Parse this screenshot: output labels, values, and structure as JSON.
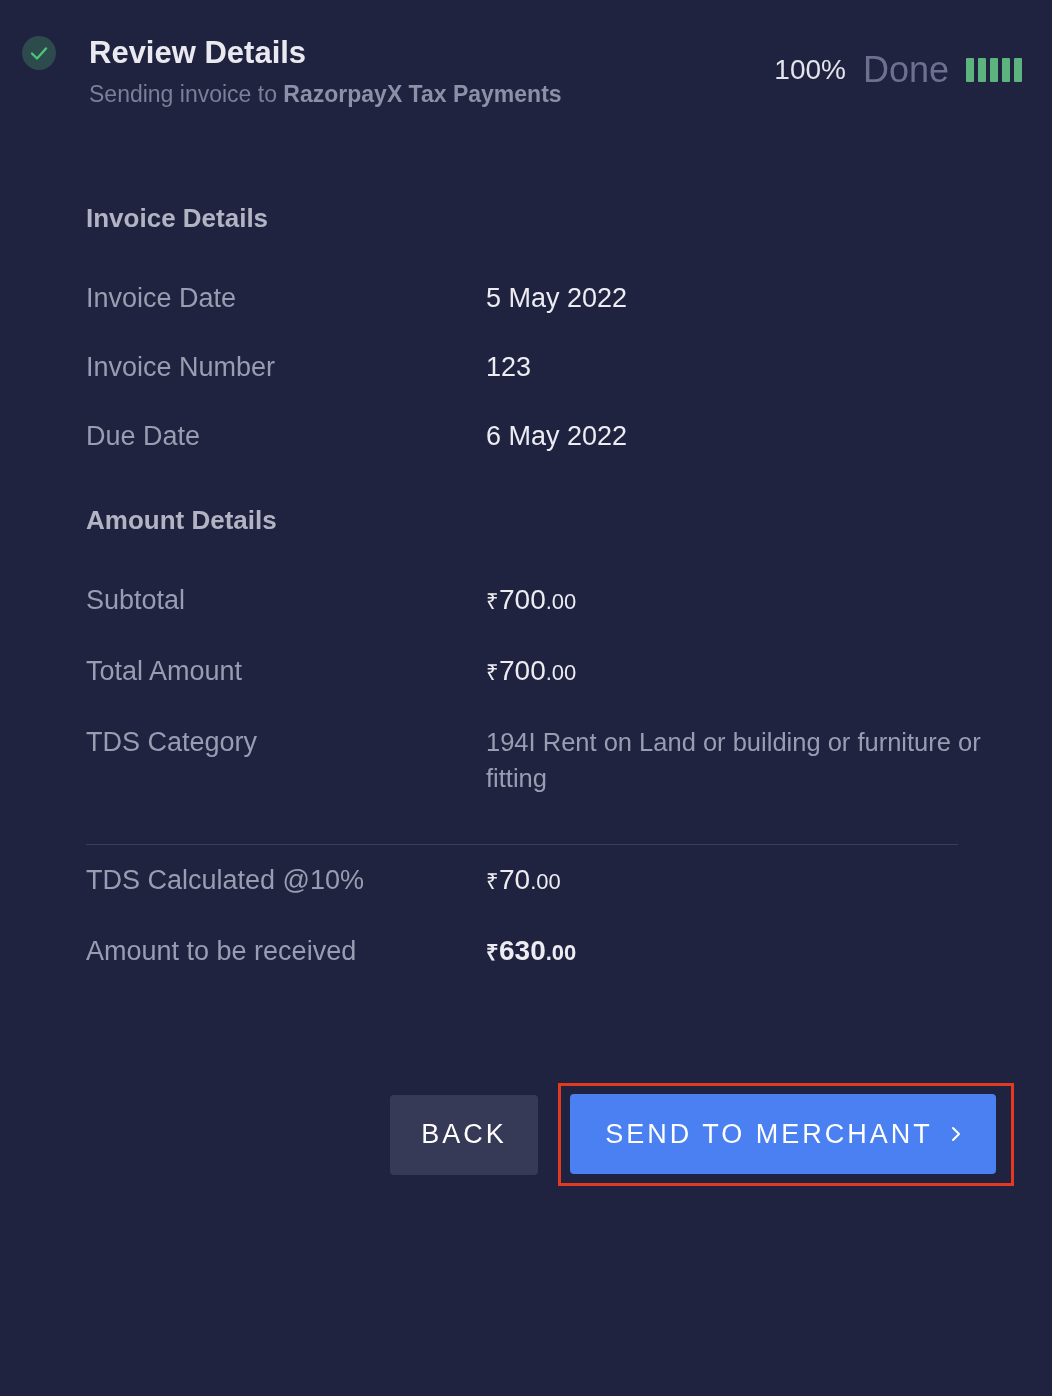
{
  "header": {
    "completed": true,
    "title": "Review Details",
    "subtitle": "Sending invoice to **RazorpayX Tax Payments**"
  },
  "progress": {
    "percent": "100%",
    "status": "Done",
    "level": 1
  },
  "sections": [
    {
      "title": "Invoice Details",
      "rows": [
        {
          "label": "Invoice Date",
          "kind": "plain",
          "value": "5 May 2022"
        },
        {
          "label": "Invoice Number",
          "kind": "plain",
          "value": "123"
        },
        {
          "label": "Due Date",
          "kind": "plain",
          "value": "6 May 2022"
        }
      ]
    },
    {
      "title": "Amount Details",
      "rows": [
        {
          "label": "Subtotal",
          "kind": "amount",
          "value": {
            "currency": "₹",
            "whole": "700",
            "fraction": ".00"
          }
        },
        {
          "label": "Total Amount",
          "kind": "amount",
          "value": {
            "currency": "₹",
            "whole": "700",
            "fraction": ".00"
          }
        },
        {
          "label": "TDS Category",
          "kind": "muted",
          "value": "194I Rent on Land or building or furniture or fitting"
        }
      ]
    },
    {
      "divider": true,
      "rows": [
        {
          "label": "TDS Calculated @10%",
          "kind": "amount",
          "value": {
            "currency": "₹",
            "whole": "70",
            "fraction": ".00"
          }
        },
        {
          "label": "Amount to be received",
          "kind": "total",
          "value": {
            "currency": "₹",
            "whole": "630",
            "fraction": ".00"
          }
        }
      ]
    }
  ],
  "buttons": [
    {
      "label": "BACK",
      "kind": "secondary",
      "highlighted": false
    },
    {
      "label": "SEND TO MERCHANT",
      "kind": "primary",
      "highlighted": true
    }
  ]
}
